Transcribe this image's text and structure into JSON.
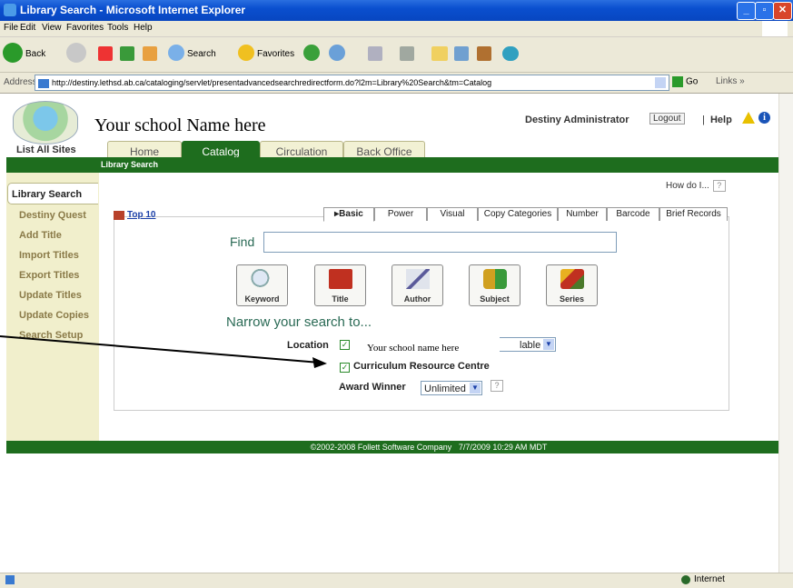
{
  "window": {
    "title": "Library Search - Microsoft Internet Explorer"
  },
  "menu": [
    "File",
    "Edit",
    "View",
    "Favorites",
    "Tools",
    "Help"
  ],
  "toolbar": {
    "back": "Back",
    "search": "Search",
    "favorites": "Favorites"
  },
  "address": {
    "label": "Address",
    "url": "http://destiny.lethsd.ab.ca/cataloging/servlet/presentadvancedsearchredirectform.do?l2m=Library%20Search&tm=Catalog",
    "go": "Go",
    "links": "Links"
  },
  "header": {
    "school_name": "Your school Name here",
    "user": "Destiny Administrator",
    "logout": "Logout",
    "help": "Help",
    "list_all_sites": "List All Sites"
  },
  "tabs": [
    "Home",
    "Catalog",
    "Circulation",
    "Back Office"
  ],
  "subnav": "Library Search",
  "leftnav": {
    "selected": "Library Search",
    "items": [
      "Destiny Quest",
      "Add Title",
      "Import Titles",
      "Export Titles",
      "Update Titles",
      "Update Copies",
      "Search Setup"
    ]
  },
  "how_do_i": "How do I...",
  "top10": "Top 10",
  "search_tabs": [
    "Basic",
    "Power",
    "Visual",
    "Copy Categories",
    "Number",
    "Barcode",
    "Brief Records"
  ],
  "find": {
    "label": "Find",
    "value": ""
  },
  "search_buttons": [
    "Keyword",
    "Title",
    "Author",
    "Subject",
    "Series"
  ],
  "narrow": {
    "heading": "Narrow your search to...",
    "location_label": "Location",
    "location_overlay": "Your school name here",
    "location_select": "lable",
    "curriculum": "Curriculum Resource Centre",
    "award_label": "Award Winner",
    "award_value": "Unlimited"
  },
  "footer": {
    "copyright": "©2002-2008  Follett Software Company",
    "datetime": "7/7/2009 10:29 AM MDT"
  },
  "status": {
    "zone": "Internet"
  },
  "colors": {
    "green": "#1e6d1e",
    "nav_bg": "#f1efcc"
  }
}
